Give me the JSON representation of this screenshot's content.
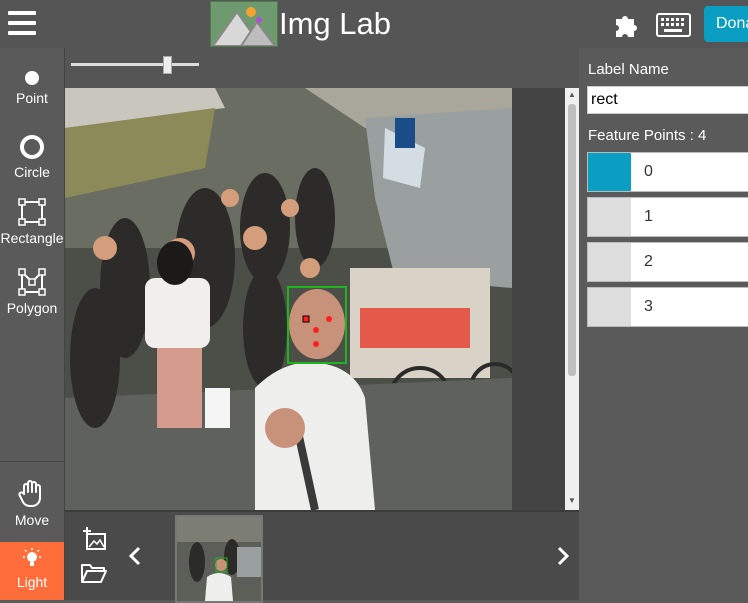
{
  "header": {
    "title": "Img Lab",
    "donate_label": "Dona"
  },
  "toolbar": {
    "items": [
      {
        "label": "Point",
        "icon": "point-icon"
      },
      {
        "label": "Circle",
        "icon": "circle-icon"
      },
      {
        "label": "Rectangle",
        "icon": "rectangle-icon"
      },
      {
        "label": "Polygon",
        "icon": "polygon-icon"
      },
      {
        "label": "Move",
        "icon": "hand-icon"
      },
      {
        "label": "Light",
        "icon": "lightbulb-icon",
        "active": true
      }
    ]
  },
  "slider": {
    "value": 0.75
  },
  "panel": {
    "label_name_title": "Label Name",
    "label_value": "rect",
    "feature_points_title": "Feature Points : 4",
    "points": [
      {
        "label": "0",
        "active": true
      },
      {
        "label": "1",
        "active": false
      },
      {
        "label": "2",
        "active": false
      },
      {
        "label": "3",
        "active": false
      }
    ]
  },
  "colors": {
    "accent": "#0a9fc2",
    "active_tool": "#ff6e3a",
    "bbox": "#1db41d",
    "point_marker": "#ff2020"
  }
}
